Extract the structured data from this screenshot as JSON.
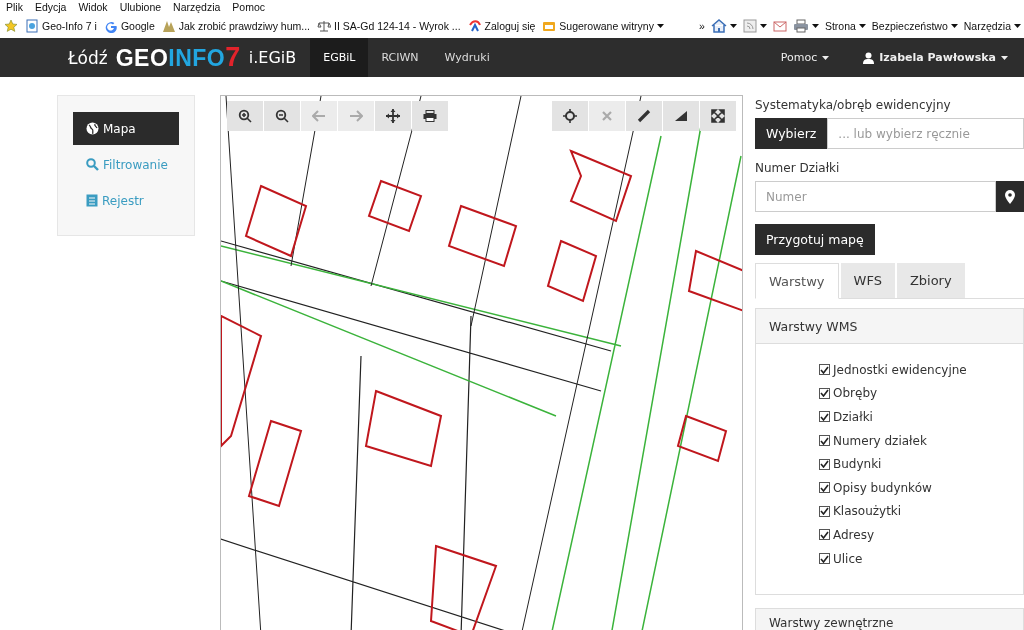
{
  "browser_menu": [
    "Plik",
    "Edycja",
    "Widok",
    "Ulubione",
    "Narzędzia",
    "Pomoc"
  ],
  "favorites": [
    {
      "kind": "page",
      "label": "Geo-Info 7 i"
    },
    {
      "kind": "google",
      "label": "Google"
    },
    {
      "label": "Jak zrobić prawdziwy hum..."
    },
    {
      "kind": "scale",
      "label": "II SA-Gd 124-14 - Wyrok ..."
    },
    {
      "kind": "login",
      "label": "Zaloguj się"
    },
    {
      "kind": "folder",
      "label": "Sugerowane witryny"
    }
  ],
  "command_bar": {
    "more": "»",
    "menus": [
      "Strona",
      "Bezpieczeństwo",
      "Narzędzia"
    ]
  },
  "navbar": {
    "city": "Łódź",
    "logo": [
      "GEO",
      "INFO",
      "7"
    ],
    "product": "i.EGiB",
    "tabs": [
      {
        "label": "EGBiL",
        "selected": true
      },
      {
        "label": "RCIWN",
        "selected": false
      },
      {
        "label": "Wydruki",
        "selected": false
      }
    ],
    "help": "Pomoc",
    "user": "Izabela Pawłowska"
  },
  "sidebar": {
    "items": [
      {
        "kind": "globe",
        "label": "Mapa",
        "selected": true
      },
      {
        "kind": "search",
        "label": "Filtrowanie",
        "selected": false
      },
      {
        "kind": "register",
        "label": "Rejestr",
        "selected": false
      }
    ]
  },
  "map": {
    "kind": "picture",
    "tools_left": [
      {
        "kind": "zoom-in",
        "disabled": false
      },
      {
        "kind": "zoom-out",
        "disabled": false
      },
      {
        "kind": "back",
        "disabled": true
      },
      {
        "kind": "forward",
        "disabled": true
      },
      {
        "kind": "pan",
        "disabled": false
      },
      {
        "kind": "print",
        "disabled": false
      }
    ],
    "tools_right": [
      {
        "kind": "locate",
        "disabled": false
      },
      {
        "kind": "clear",
        "disabled": true
      },
      {
        "kind": "measure-line",
        "disabled": false
      },
      {
        "kind": "measure-area",
        "disabled": false
      },
      {
        "kind": "fullscreen",
        "disabled": false
      }
    ]
  },
  "panel": {
    "precinct_label": "Systematyka/obręb ewidencyjny",
    "choose_button": "Wybierz",
    "precinct_placeholder": "... lub wybierz ręcznie",
    "parcel_label": "Numer Działki",
    "parcel_placeholder": "Numer",
    "prepare_button": "Przygotuj mapę",
    "tabs": [
      {
        "label": "Warstwy",
        "selected": true
      },
      {
        "label": "WFS",
        "selected": false
      },
      {
        "label": "Zbiory",
        "selected": false
      }
    ],
    "wms_heading": "Warstwy WMS",
    "layers": [
      {
        "label": "Jednostki ewidencyjne",
        "checked": true
      },
      {
        "label": "Obręby",
        "checked": true
      },
      {
        "label": "Działki",
        "checked": true
      },
      {
        "label": "Numery działek",
        "checked": true
      },
      {
        "label": "Budynki",
        "checked": true
      },
      {
        "label": "Opisy budynków",
        "checked": true
      },
      {
        "label": "Klasoużytki",
        "checked": true
      },
      {
        "label": "Adresy",
        "checked": true
      },
      {
        "label": "Ulice",
        "checked": true
      }
    ],
    "external_heading": "Warstwy zewnętrzne"
  }
}
